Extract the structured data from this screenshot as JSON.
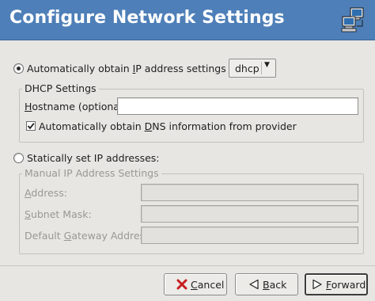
{
  "window": {
    "title": "Configure Network Settings",
    "icon": "network-computers-icon"
  },
  "auto": {
    "label_before": "Automatically obtain ",
    "label_mnemonic": "I",
    "label_after": "P address settings with:",
    "selected": true,
    "method": "dhcp"
  },
  "dhcp": {
    "frame_title": "DHCP Settings",
    "hostname_mnemonic": "H",
    "hostname_rest": "ostname (optional):",
    "hostname_value": "",
    "dns_before": "Automatically obtain ",
    "dns_mnemonic": "D",
    "dns_after": "NS information from provider",
    "dns_checked": true
  },
  "static": {
    "label": "Statically set IP addresses:",
    "selected": false
  },
  "manual": {
    "frame_title": "Manual IP Address Settings",
    "address_mnemonic": "A",
    "address_rest": "ddress:",
    "address_value": "",
    "subnet_mnemonic": "S",
    "subnet_rest": "ubnet Mask:",
    "subnet_value": "",
    "gateway_before": "Default ",
    "gateway_mnemonic": "G",
    "gateway_after": "ateway Address:",
    "gateway_value": ""
  },
  "buttons": {
    "cancel_mnemonic": "C",
    "cancel_rest": "ancel",
    "back_mnemonic": "B",
    "back_rest": "ack",
    "forward_mnemonic": "F",
    "forward_rest": "orward"
  }
}
